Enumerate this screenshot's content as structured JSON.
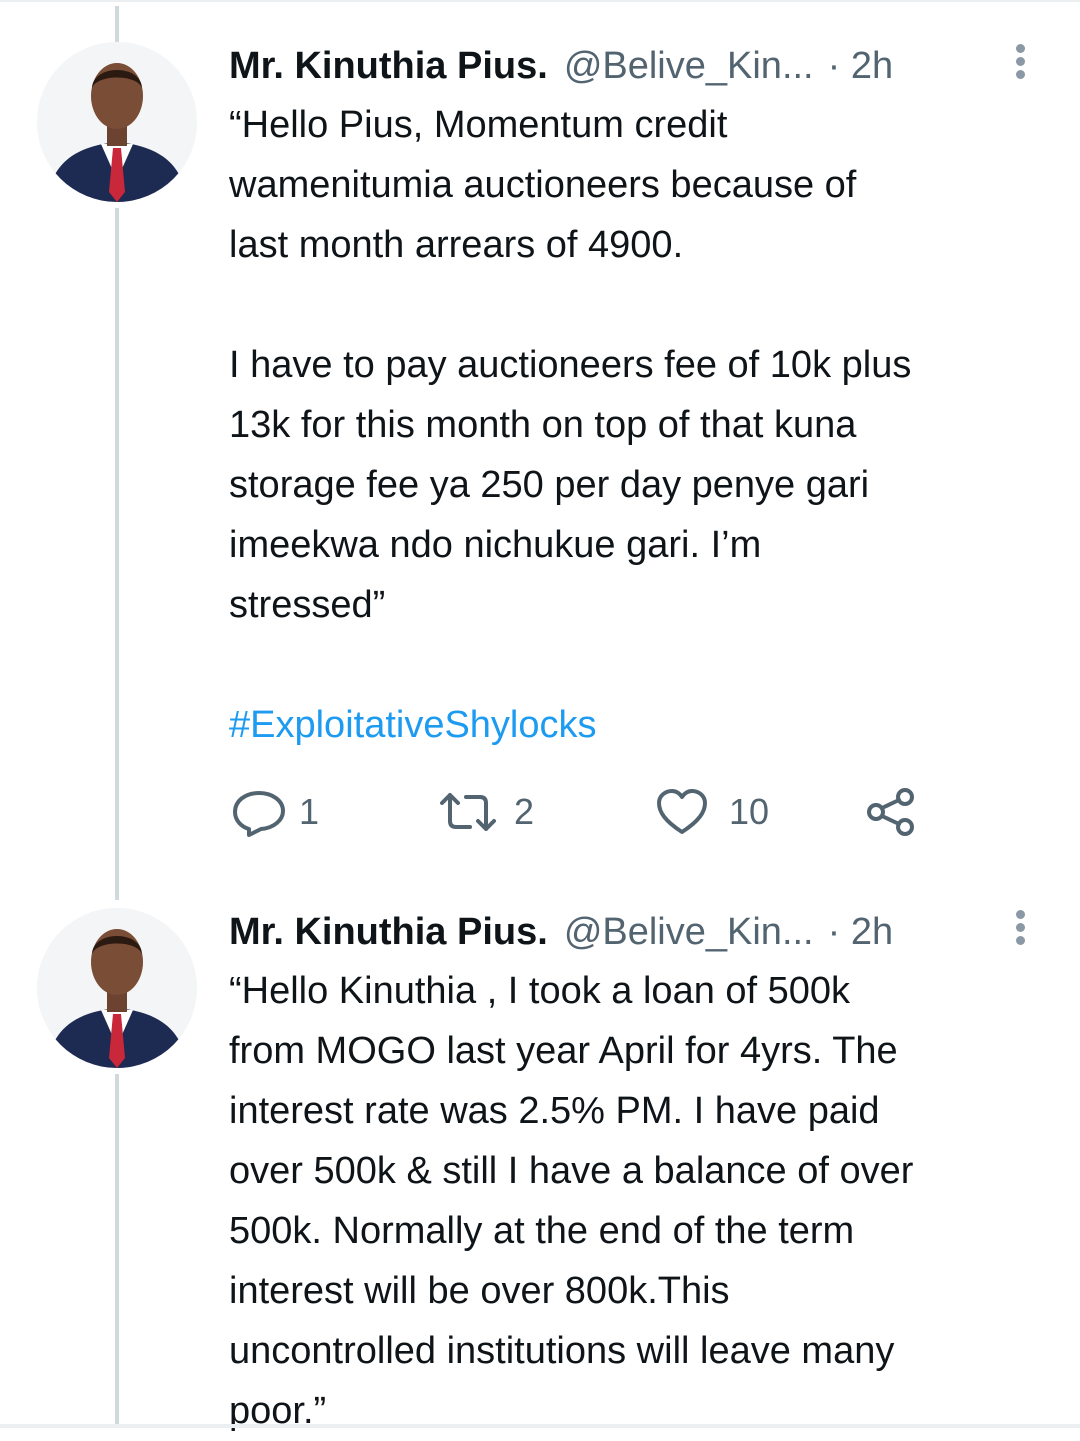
{
  "tweets": [
    {
      "author_name": "Mr. Kinuthia Pius.",
      "handle": "@Belive_Kin...",
      "time": "· 2h",
      "paragraphs": [
        [
          "“Hello Pius, Momentum credit",
          "wamenitumia auctioneers because of",
          "last month arrears of 4900."
        ],
        [
          "I have to pay auctioneers fee of 10k plus",
          "13k for this month on top of that kuna",
          "storage fee ya 250 per day penye gari",
          "imeekwa ndo nichukue gari. I’m",
          "stressed”"
        ]
      ],
      "hashtag": "#ExploitativeShylocks",
      "actions": {
        "reply_icon": "reply-icon",
        "reply_count": "1",
        "retweet_icon": "retweet-icon",
        "retweet_count": "2",
        "like_icon": "heart-icon",
        "like_count": "10",
        "share_icon": "share-icon"
      }
    },
    {
      "author_name": "Mr. Kinuthia Pius.",
      "handle": "@Belive_Kin...",
      "time": "· 2h",
      "paragraphs": [
        [
          "“Hello Kinuthia , I took a loan of 500k",
          "from MOGO last year April for 4yrs. The",
          "interest rate was 2.5% PM. I have paid",
          "over 500k & still I have a balance of over",
          "500k. Normally at the end of the term",
          "interest will be over 800k.This",
          "uncontrolled institutions will leave many",
          "poor.”"
        ]
      ]
    }
  ],
  "colors": {
    "text": "#0f1419",
    "secondary": "#536471",
    "link": "#1d9bf0",
    "thread_line": "#cfd9de"
  }
}
